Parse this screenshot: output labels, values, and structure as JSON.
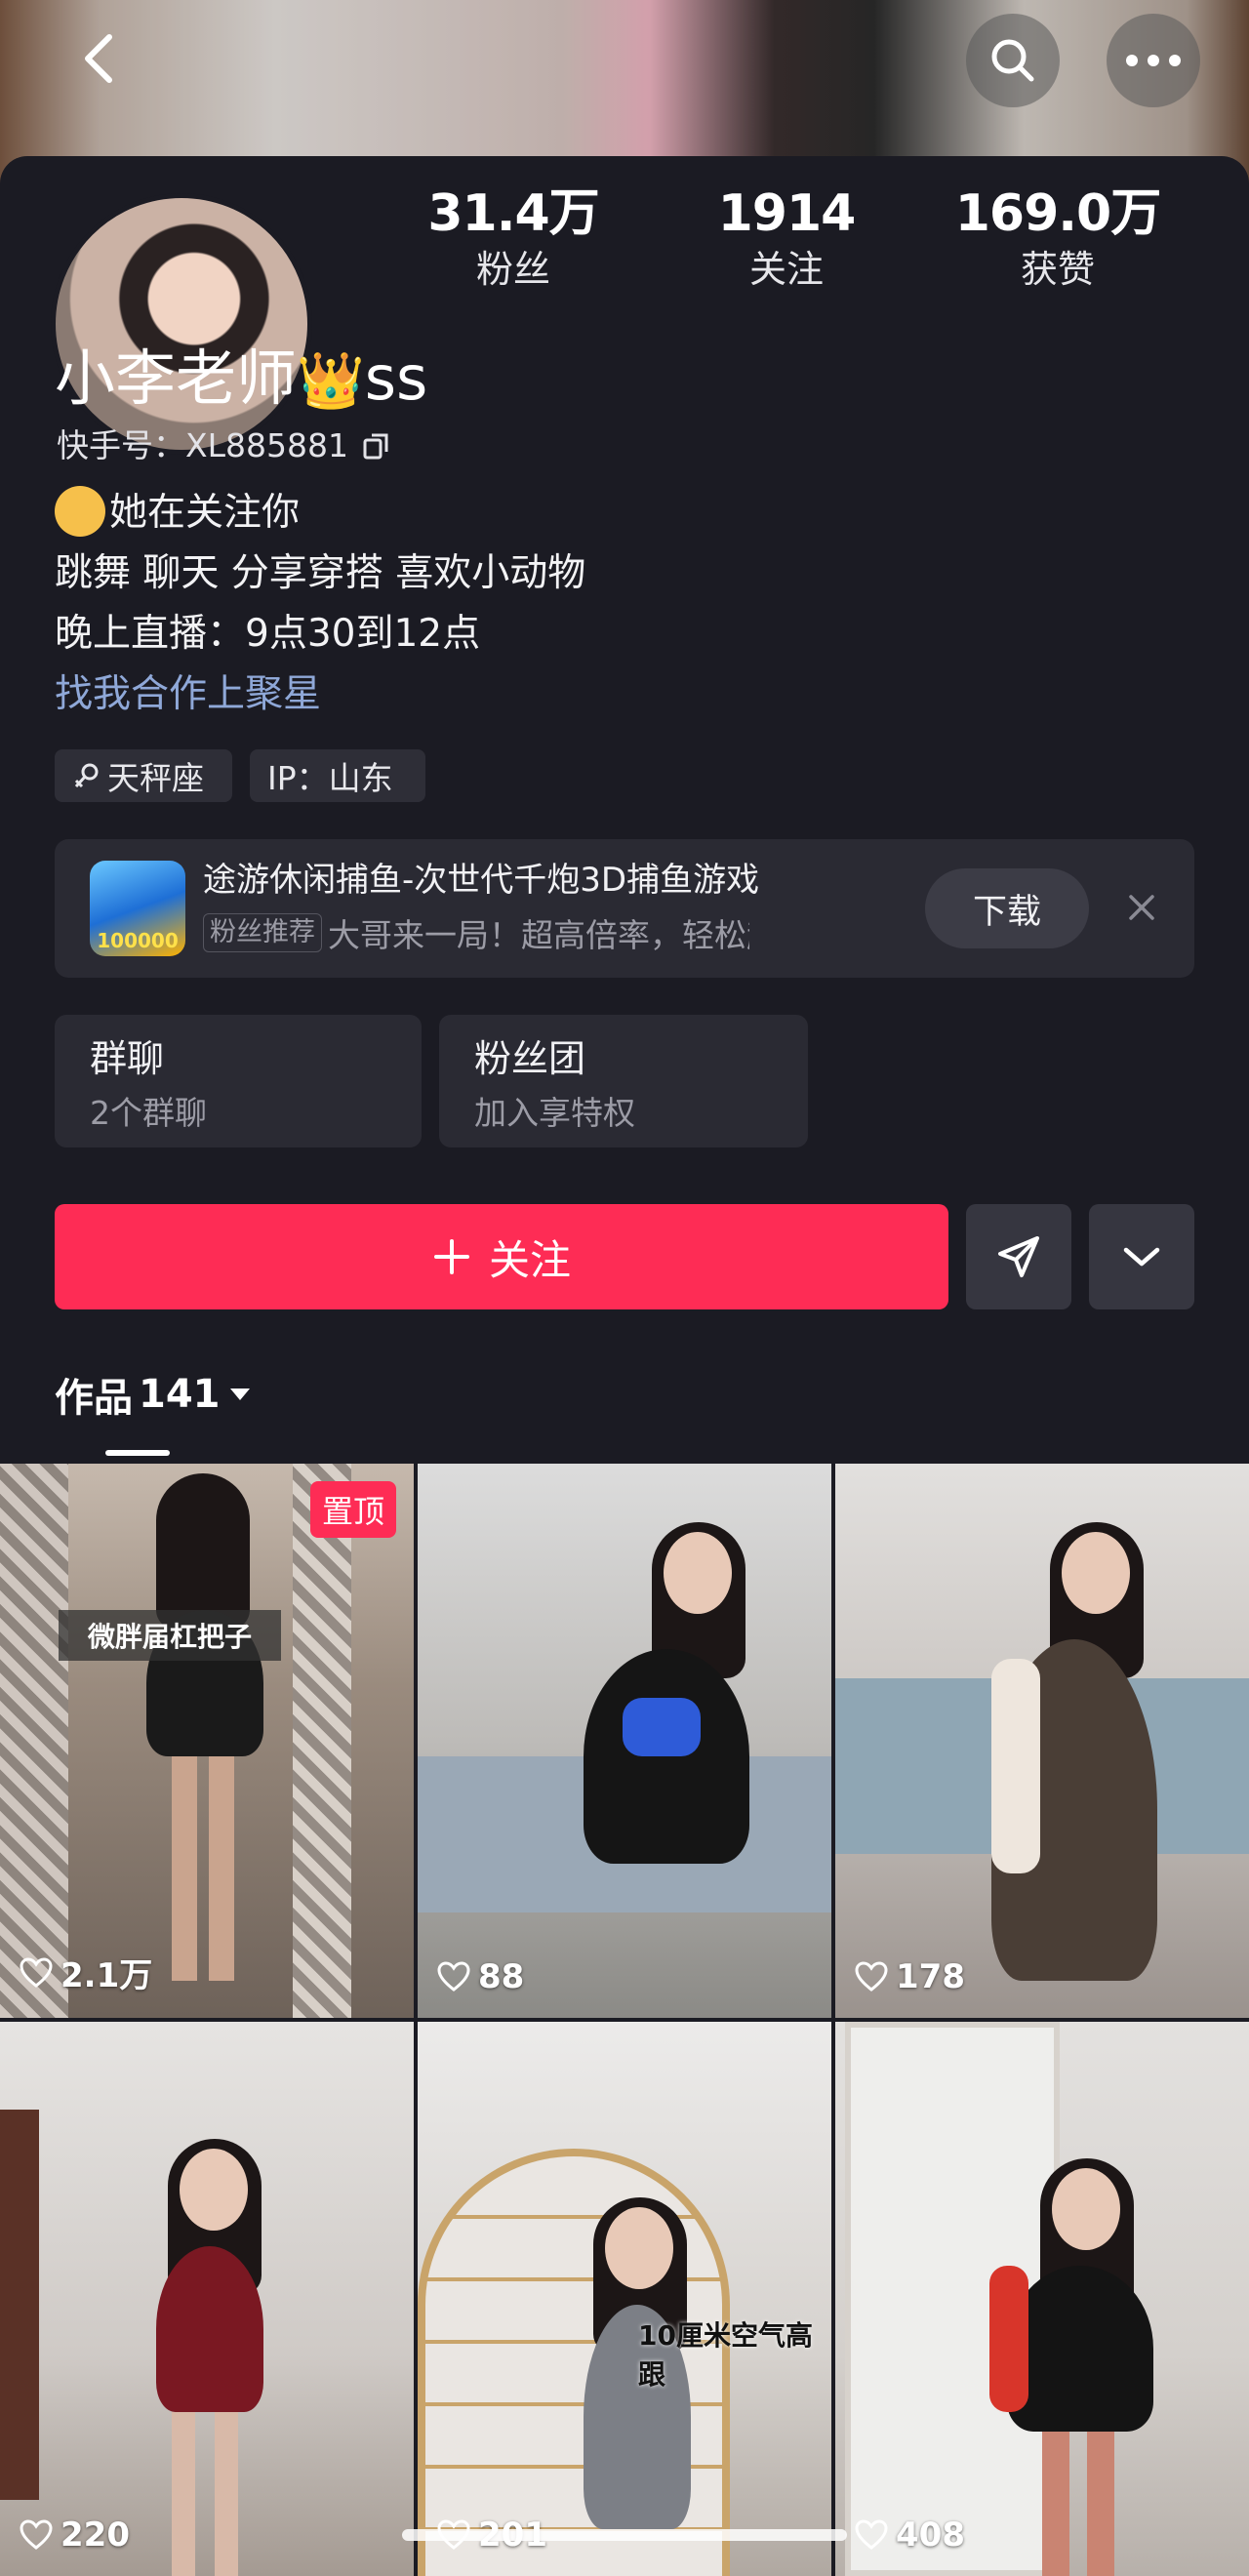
{
  "nav": {
    "back_icon": "chevron-left-icon",
    "search_icon": "search-icon",
    "more_icon": "more-dots-icon"
  },
  "stats": [
    {
      "value": "31.4万",
      "label": "粉丝"
    },
    {
      "value": "1914",
      "label": "关注"
    },
    {
      "value": "169.0万",
      "label": "获赞"
    }
  ],
  "profile": {
    "name": "小李老师",
    "name_suffix": "ss",
    "crown": "👑",
    "kuaishou_id": "快手号：XL885881",
    "bio": {
      "following_note": "她在关注你",
      "line1": "跳舞 聊天  分享穿搭 喜欢小动物",
      "line2": "晚上直播：9点30到12点",
      "link": "找我合作上聚星"
    },
    "tags": [
      "天秤座",
      "IP：山东"
    ]
  },
  "ad": {
    "title": "途游休闲捕鱼-次世代千炮3D捕鱼游戏",
    "badge": "粉丝推荐",
    "desc": "大哥来一局！超高倍率，轻松起…",
    "icon_badge": "100000",
    "download_label": "下载"
  },
  "cards": [
    {
      "title": "群聊",
      "sub": "2个群聊"
    },
    {
      "title": "粉丝团",
      "sub": "加入享特权"
    }
  ],
  "actions": {
    "follow_label": "关注"
  },
  "tabs": {
    "works_label": "作品",
    "works_count": "141"
  },
  "videos": [
    {
      "likes": "2.1万",
      "pinned": "置顶",
      "caption": "微胖届杠把子"
    },
    {
      "likes": "88"
    },
    {
      "likes": "178"
    },
    {
      "likes": "220"
    },
    {
      "likes": "201",
      "caption": "10厘米空气高跟"
    },
    {
      "likes": "408"
    }
  ],
  "colors": {
    "accent": "#fe2c55",
    "background": "#1b1b23",
    "link": "#8fa8d8"
  }
}
